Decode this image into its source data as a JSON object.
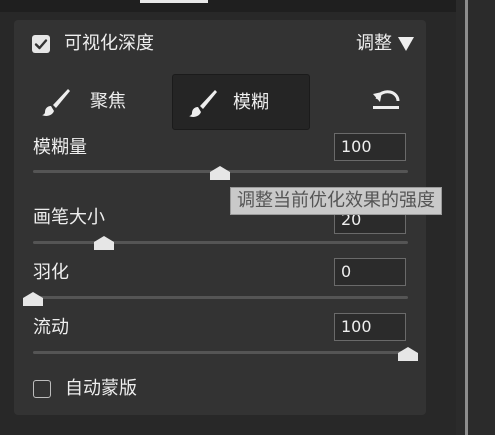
{
  "header": {
    "checkbox_checked": true,
    "title": "可视化深度",
    "adjust_label": "调整",
    "caret_icon": "triangle-down-icon"
  },
  "modes": [
    {
      "label": "聚焦",
      "icon": "brush-icon",
      "active": false
    },
    {
      "label": "模糊",
      "icon": "brush-icon",
      "active": true
    }
  ],
  "reset_icon": "reset-arrow-icon",
  "sliders": [
    {
      "label": "模糊量",
      "value": "100",
      "level": 0.5
    },
    {
      "label": "画笔大小",
      "value": "20",
      "level": 0.19
    },
    {
      "label": "羽化",
      "value": "0",
      "level": 0.0
    },
    {
      "label": "流动",
      "value": "100",
      "level": 1.0
    }
  ],
  "tooltip": "调整当前优化效果的强度",
  "auto_mask": {
    "label": "自动蒙版",
    "checked": false
  },
  "colors": {
    "panel": "#333333",
    "background": "#282828",
    "track": "#555555",
    "thumb": "#e6e6e6"
  }
}
